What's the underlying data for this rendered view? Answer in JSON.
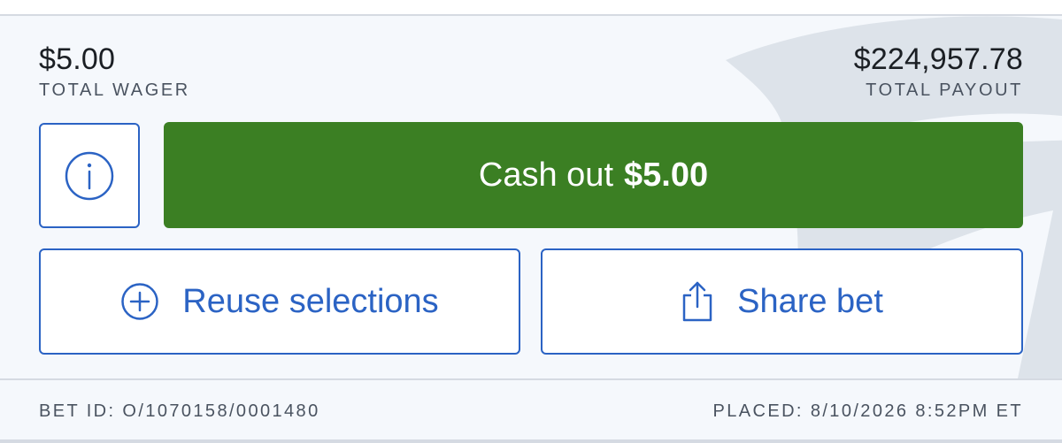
{
  "wager": {
    "amount": "$5.00",
    "label": "TOTAL WAGER"
  },
  "payout": {
    "amount": "$224,957.78",
    "label": "TOTAL PAYOUT"
  },
  "info": {
    "icon": "info-icon"
  },
  "cashout": {
    "prefix": "Cash out",
    "amount": "$5.00",
    "color": "#3b7f23"
  },
  "actions": {
    "reuse": {
      "label": "Reuse selections",
      "icon": "plus-circle-icon"
    },
    "share": {
      "label": "Share bet",
      "icon": "share-icon"
    }
  },
  "footer": {
    "bet_id": "BET ID: O/1070158/0001480",
    "placed": "PLACED: 8/10/2026 8:52PM ET"
  },
  "colors": {
    "accent": "#2b63c4",
    "background": "#f5f8fc",
    "text": "#1b1f24",
    "muted": "#4a5360"
  }
}
